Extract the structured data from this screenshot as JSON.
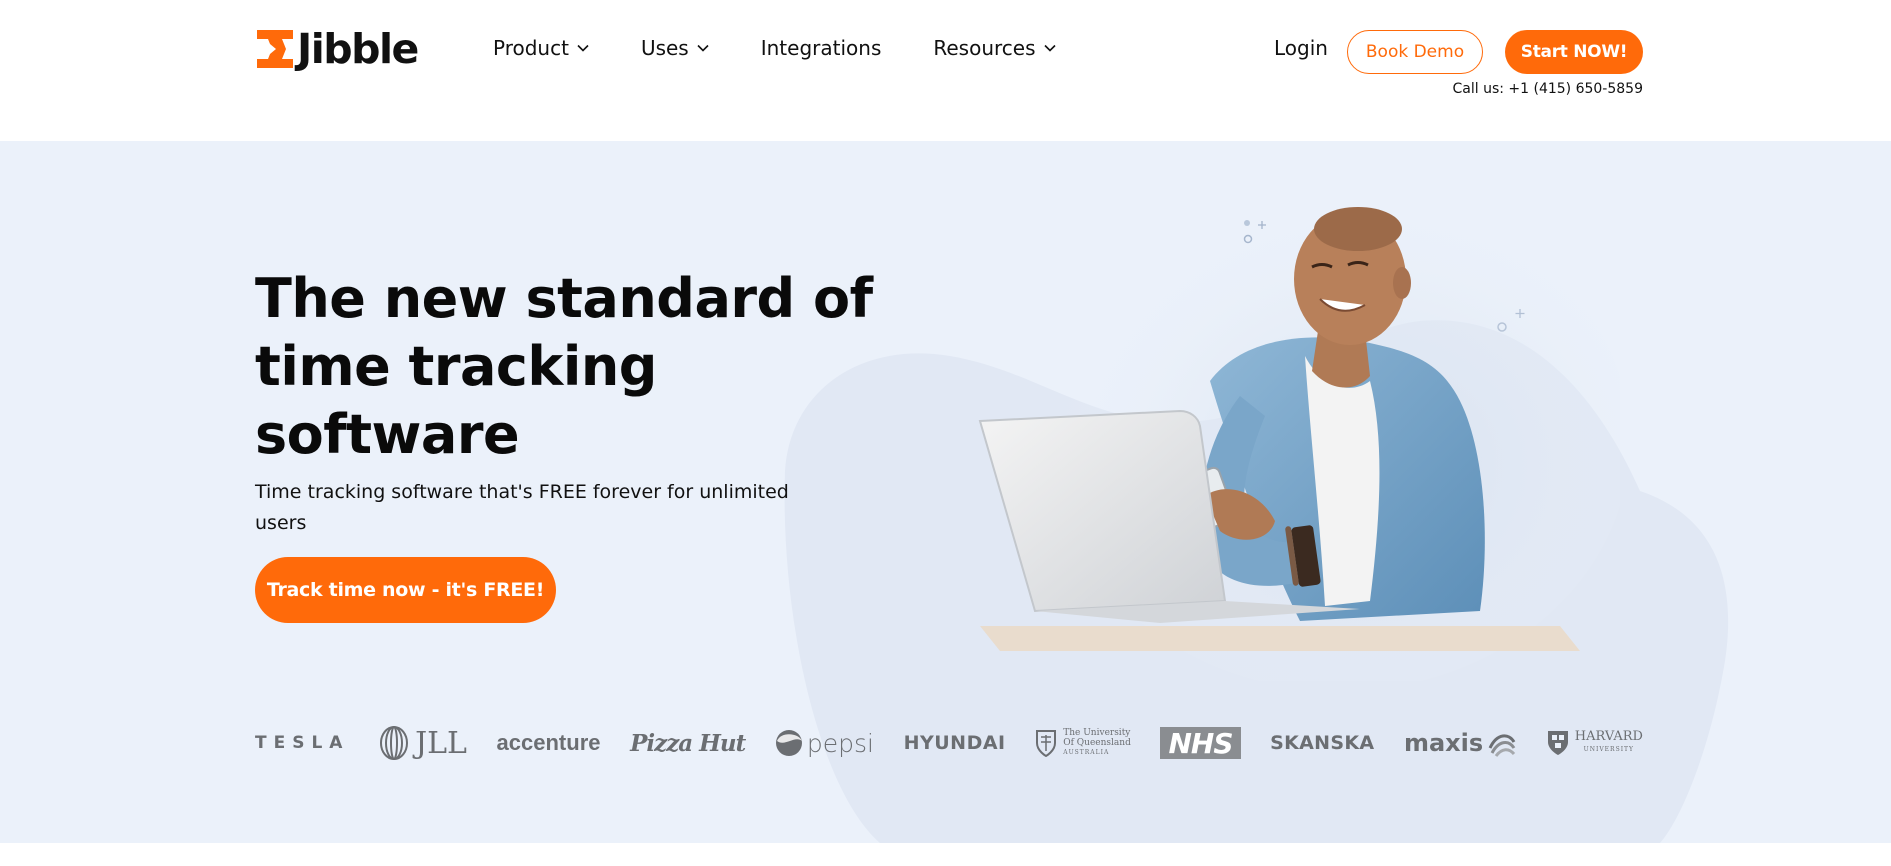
{
  "header": {
    "logo_text": "Jibble",
    "nav": [
      {
        "label": "Product",
        "has_dropdown": true
      },
      {
        "label": "Uses",
        "has_dropdown": true
      },
      {
        "label": "Integrations",
        "has_dropdown": false
      },
      {
        "label": "Resources",
        "has_dropdown": true
      }
    ],
    "login_label": "Login",
    "book_demo_label": "Book Demo",
    "start_label": "Start NOW!",
    "call_text": "Call us: +1 (415) 650-5859"
  },
  "hero": {
    "headline": "The new standard of time tracking software",
    "subtext": "Time tracking software that's FREE forever for unlimited users",
    "cta_label": "Track time now - it's FREE!"
  },
  "logos": {
    "tesla": "TESLA",
    "jll": "JLL",
    "accenture": "accenture",
    "pizza_hut": "Pizza Hut",
    "pepsi": "pepsi",
    "hyundai": "HYUNDAI",
    "uq_line1": "The University",
    "uq_line2": "Of Queensland",
    "uq_line3": "AUSTRALIA",
    "nhs": "NHS",
    "skanska": "SKANSKA",
    "maxis": "maxis",
    "harvard_line1": "HARVARD",
    "harvard_line2": "UNIVERSITY"
  },
  "colors": {
    "brand_orange": "#ff6a0a",
    "hero_background": "#ebf1fa",
    "logo_grey": "#6b6e72"
  }
}
